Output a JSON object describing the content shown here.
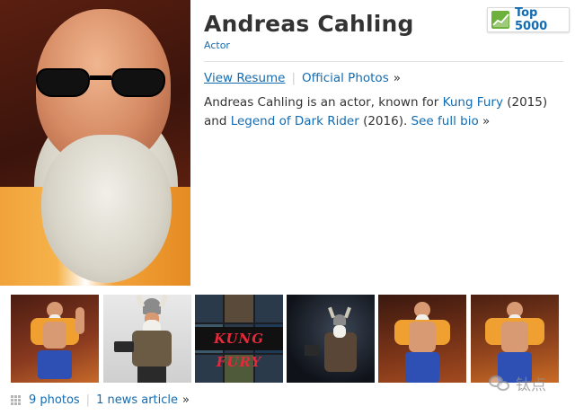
{
  "profile": {
    "name": "Andreas Cahling",
    "role": "Actor",
    "badge": "Top 5000",
    "links": {
      "resume": "View Resume",
      "photos": "Official Photos",
      "raquo": "»"
    },
    "bio": {
      "prefix": "Andreas Cahling is an actor, known for ",
      "film1": "Kung Fury",
      "film1_year": " (2015)",
      "conj": "and ",
      "film2": "Legend of Dark Rider",
      "film2_year": " (2016). ",
      "more": "See full bio",
      "raquo": " »"
    }
  },
  "media": {
    "kungfury_logo": "KUNG FURY",
    "footer": {
      "photos": "9 photos",
      "news": "1 news article",
      "raquo": "»"
    }
  },
  "watermark": {
    "text": "钛点"
  },
  "colors": {
    "link": "#136cb2",
    "badge_green": "#6db03b"
  },
  "icons": [
    "trend-chart-icon",
    "photo-grid-icon",
    "wechat-icon"
  ]
}
